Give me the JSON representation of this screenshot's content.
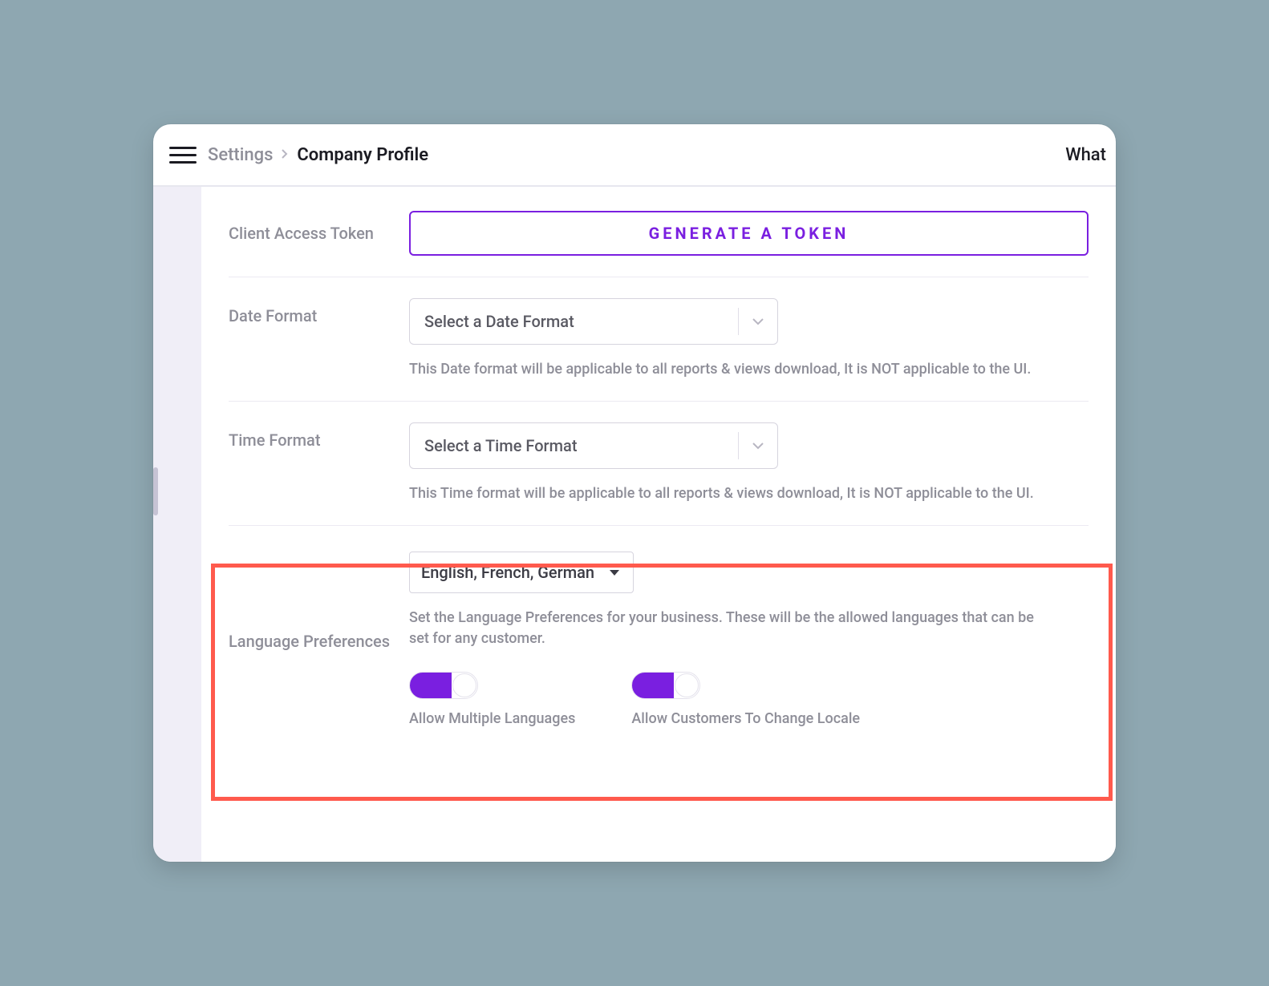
{
  "breadcrumb": {
    "settings": "Settings",
    "company": "Company Profile"
  },
  "header": {
    "right": "What"
  },
  "sections": {
    "token": {
      "label": "Client Access Token",
      "button": "GENERATE A TOKEN"
    },
    "date": {
      "label": "Date Format",
      "placeholder": "Select a Date Format",
      "help": "This Date format will be applicable to all reports & views download, It is NOT applicable to the UI."
    },
    "time": {
      "label": "Time Format",
      "placeholder": "Select a Time Format",
      "help": "This Time format will be applicable to all reports & views download, It is NOT applicable to the UI."
    },
    "lang": {
      "label": "Language Preferences",
      "value": "English, French, German",
      "help": "Set the Language Preferences for your business. These will be the allowed languages that can be set for any customer.",
      "toggle1": "Allow Multiple Languages",
      "toggle2": "Allow Customers To Change Locale"
    }
  }
}
